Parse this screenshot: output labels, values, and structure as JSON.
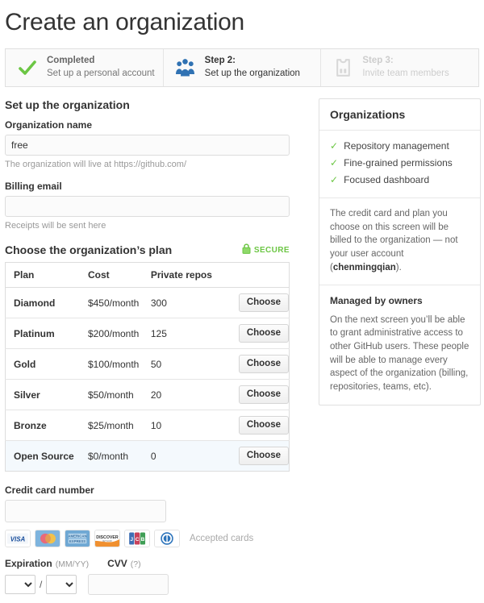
{
  "page": {
    "title": "Create an organization"
  },
  "steps": [
    {
      "icon": "checkmark-icon",
      "title": "Completed",
      "sub": "Set up a personal account",
      "state": "completed"
    },
    {
      "icon": "organization-people-icon",
      "title": "Step 2:",
      "sub": "Set up the organization",
      "state": "current"
    },
    {
      "icon": "team-jersey-icon",
      "title": "Step 3:",
      "sub": "Invite team members",
      "state": "disabled"
    }
  ],
  "form": {
    "section_title": "Set up the organization",
    "org_name": {
      "label": "Organization name",
      "value": "free",
      "placeholder": "",
      "hint": "The organization will live at https://github.com/"
    },
    "billing_email": {
      "label": "Billing email",
      "value": "",
      "placeholder": "",
      "hint": "Receipts will be sent here"
    }
  },
  "plans": {
    "heading": "Choose the organization’s plan",
    "secure_label": "SECURE",
    "secure_icon": "lock-icon",
    "secure_color": "#6cc644",
    "columns": [
      "Plan",
      "Cost",
      "Private repos",
      ""
    ],
    "choose_label": "Choose",
    "rows": [
      {
        "plan": "Diamond",
        "cost": "$450/month",
        "repos": "300",
        "highlight": false
      },
      {
        "plan": "Platinum",
        "cost": "$200/month",
        "repos": "125",
        "highlight": false
      },
      {
        "plan": "Gold",
        "cost": "$100/month",
        "repos": "50",
        "highlight": false
      },
      {
        "plan": "Silver",
        "cost": "$50/month",
        "repos": "20",
        "highlight": false
      },
      {
        "plan": "Bronze",
        "cost": "$25/month",
        "repos": "10",
        "highlight": false
      },
      {
        "plan": "Open Source",
        "cost": "$0/month",
        "repos": "0",
        "highlight": true
      }
    ]
  },
  "sidebar": {
    "title": "Organizations",
    "features": [
      "Repository management",
      "Fine-grained permissions",
      "Focused dashboard"
    ],
    "billing_note_pre": "The credit card and plan you choose on this screen will be billed to the organization — not your user account (",
    "billing_note_user": "chenmingqian",
    "billing_note_post": ").",
    "owners_title": "Managed by owners",
    "owners_body": "On the next screen you’ll be able to grant administrative access to other GitHub users. These people will be able to manage every aspect of the organization (billing, repositories, teams, etc)."
  },
  "credit_card": {
    "number_label": "Credit card number",
    "number_value": "",
    "number_placeholder": "",
    "accepted_label": "Accepted cards",
    "cards": [
      {
        "name": "visa-card-icon",
        "text": "VISA"
      },
      {
        "name": "mastercard-card-icon",
        "text": ""
      },
      {
        "name": "amex-card-icon",
        "text": "AMERICAN EXPRESS"
      },
      {
        "name": "discover-card-icon",
        "text": "DISCOVER"
      },
      {
        "name": "jcb-card-icon",
        "text": "JCB"
      },
      {
        "name": "diners-club-card-icon",
        "text": ""
      }
    ],
    "expiration_label": "Expiration",
    "expiration_format": "(MM/YY)",
    "expiration_month": "",
    "expiration_year": "",
    "separator": "/",
    "cvv_label": "CVV",
    "cvv_help": "(?)",
    "cvv_value": "",
    "cvv_placeholder": ""
  }
}
